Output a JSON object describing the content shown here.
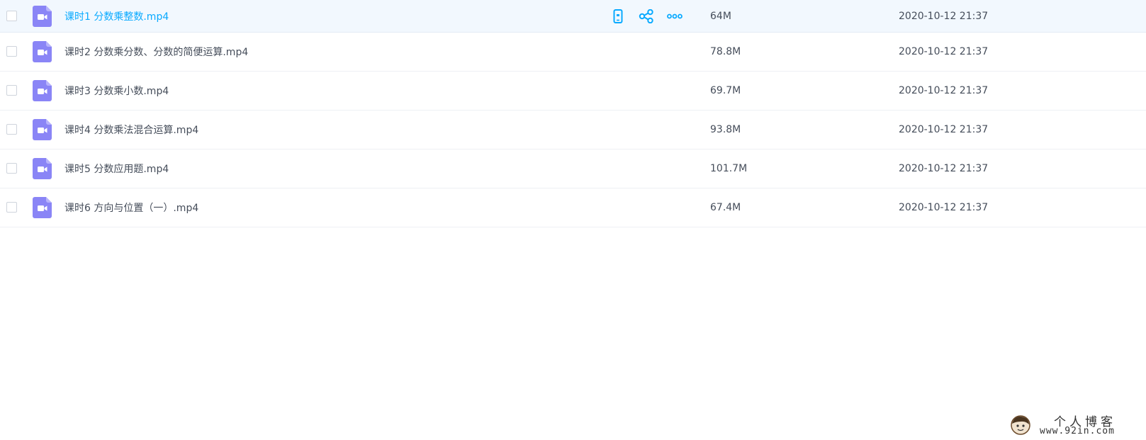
{
  "files": [
    {
      "name": "课时1 分数乘整数.mp4",
      "size": "64M",
      "date": "2020-10-12 21:37"
    },
    {
      "name": "课时2 分数乘分数、分数的简便运算.mp4",
      "size": "78.8M",
      "date": "2020-10-12 21:37"
    },
    {
      "name": "课时3 分数乘小数.mp4",
      "size": "69.7M",
      "date": "2020-10-12 21:37"
    },
    {
      "name": "课时4 分数乘法混合运算.mp4",
      "size": "93.8M",
      "date": "2020-10-12 21:37"
    },
    {
      "name": "课时5 分数应用题.mp4",
      "size": "101.7M",
      "date": "2020-10-12 21:37"
    },
    {
      "name": "课时6 方向与位置（一）.mp4",
      "size": "67.4M",
      "date": "2020-10-12 21:37"
    }
  ],
  "hover_actions": {
    "icons": [
      "phone-icon",
      "share-icon",
      "more-icon"
    ]
  },
  "watermark": {
    "title": "个人博客",
    "url": "www.92in.com"
  },
  "colors": {
    "accent": "#09aaff",
    "video_icon": "#8a85f6",
    "hover_row": "#f2f8fe",
    "text": "#454d5a"
  }
}
